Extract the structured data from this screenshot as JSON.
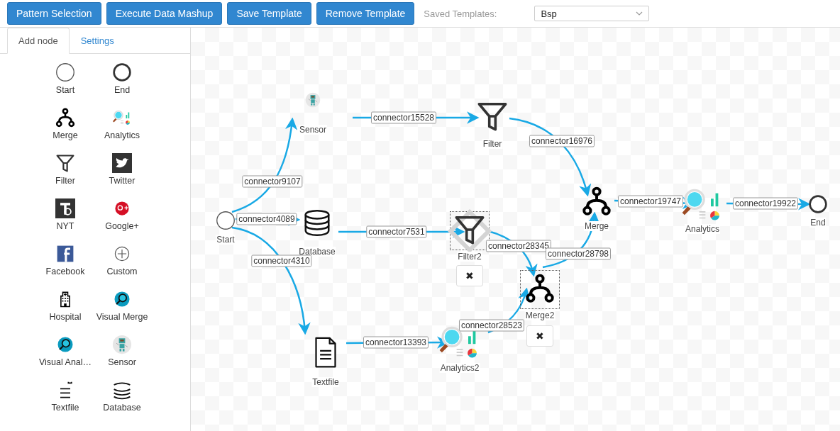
{
  "toolbar": {
    "buttons": [
      "Pattern Selection",
      "Execute Data Mashup",
      "Save Template",
      "Remove Template"
    ],
    "saved_templates": {
      "label": "Saved Templates:",
      "value": "Bsp"
    }
  },
  "tabs": [
    {
      "label": "Add node",
      "selected": true
    },
    {
      "label": "Settings",
      "selected": false
    }
  ],
  "palette": [
    {
      "label": "Start",
      "kind": "start"
    },
    {
      "label": "End",
      "kind": "end"
    },
    {
      "label": "Merge",
      "kind": "merge"
    },
    {
      "label": "Analytics",
      "kind": "analytics"
    },
    {
      "label": "Filter",
      "kind": "filter"
    },
    {
      "label": "Twitter",
      "kind": "twitter"
    },
    {
      "label": "NYT",
      "kind": "nyt"
    },
    {
      "label": "Google+",
      "kind": "googleplus"
    },
    {
      "label": "Facebook",
      "kind": "facebook"
    },
    {
      "label": "Custom",
      "kind": "custom"
    },
    {
      "label": "Hospital",
      "kind": "hospital"
    },
    {
      "label": "Visual Merge",
      "kind": "visual"
    },
    {
      "label": "Visual Anal…",
      "kind": "visual"
    },
    {
      "label": "Sensor",
      "kind": "sensor"
    },
    {
      "label": "Textfile",
      "kind": "textfile"
    },
    {
      "label": "Database",
      "kind": "database"
    }
  ],
  "canvas": {
    "nodes": [
      {
        "label": "Sensor",
        "kind": "sensor",
        "selected": false
      },
      {
        "label": "Filter",
        "kind": "filter",
        "selected": false
      },
      {
        "label": "Start",
        "kind": "start",
        "selected": false
      },
      {
        "label": "Database",
        "kind": "database",
        "selected": false
      },
      {
        "label": "Filter2",
        "kind": "filter",
        "selected": true,
        "delete_button": "✖"
      },
      {
        "label": "Merge",
        "kind": "merge",
        "selected": false
      },
      {
        "label": "Analytics",
        "kind": "analytics",
        "selected": false
      },
      {
        "label": "End",
        "kind": "end",
        "selected": false
      },
      {
        "label": "Merge2",
        "kind": "merge",
        "selected": true,
        "delete_button": "✖"
      },
      {
        "label": "Textfile",
        "kind": "textfile",
        "selected": false
      },
      {
        "label": "Analytics2",
        "kind": "analytics",
        "selected": false
      }
    ],
    "connectors": [
      {
        "label": "connector15528"
      },
      {
        "label": "connector9107"
      },
      {
        "label": "connector4089"
      },
      {
        "label": "connector16976"
      },
      {
        "label": "connector19747"
      },
      {
        "label": "connector19922"
      },
      {
        "label": "connector7531"
      },
      {
        "label": "connector4310"
      },
      {
        "label": "connector28345"
      },
      {
        "label": "connector28798"
      },
      {
        "label": "connector28523"
      },
      {
        "label": "connector13393"
      }
    ]
  }
}
